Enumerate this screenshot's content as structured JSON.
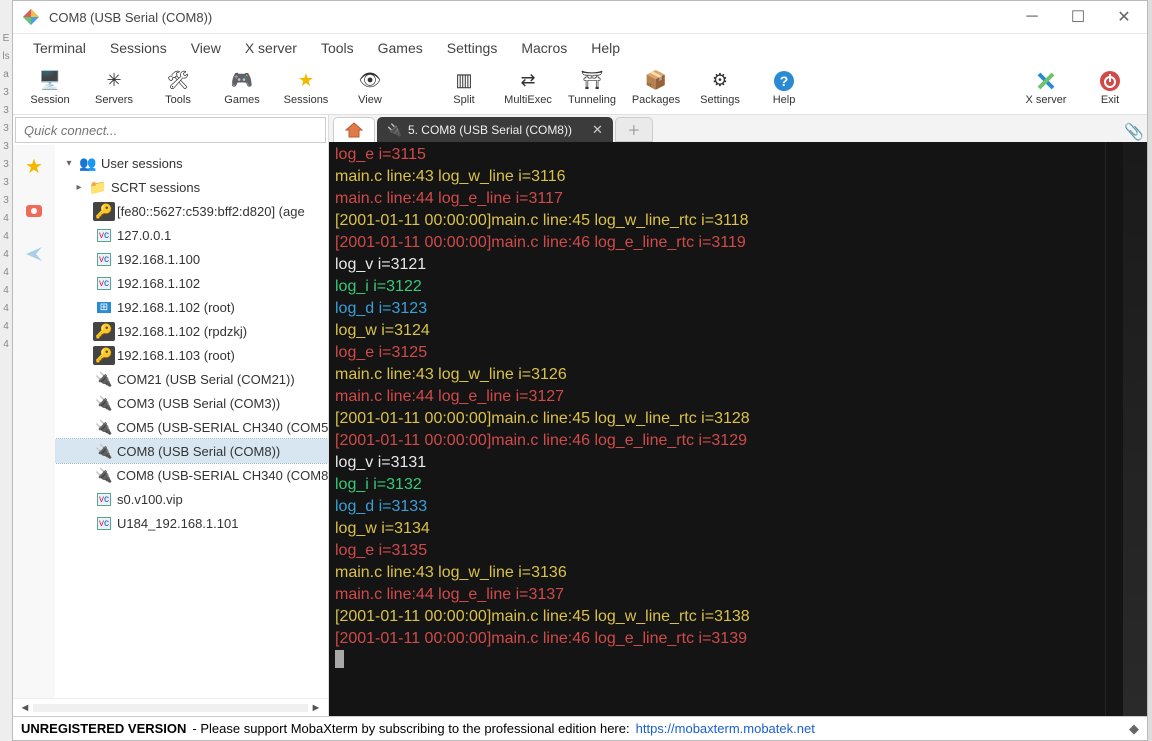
{
  "window": {
    "title": "COM8  (USB Serial (COM8))"
  },
  "menu": [
    "Terminal",
    "Sessions",
    "View",
    "X server",
    "Tools",
    "Games",
    "Settings",
    "Macros",
    "Help"
  ],
  "toolbar": [
    {
      "id": "session",
      "label": "Session",
      "icon": "🖥️"
    },
    {
      "id": "servers",
      "label": "Servers",
      "icon": "✳"
    },
    {
      "id": "tools",
      "label": "Tools",
      "icon": "🛠"
    },
    {
      "id": "games",
      "label": "Games",
      "icon": "🎮"
    },
    {
      "id": "sessions",
      "label": "Sessions",
      "icon": "⭐"
    },
    {
      "id": "view",
      "label": "View",
      "icon": "👁"
    },
    {
      "id": "split",
      "label": "Split",
      "icon": "▥"
    },
    {
      "id": "multiexec",
      "label": "MultiExec",
      "icon": "⇄"
    },
    {
      "id": "tunneling",
      "label": "Tunneling",
      "icon": "⛩"
    },
    {
      "id": "packages",
      "label": "Packages",
      "icon": "📦"
    },
    {
      "id": "settings",
      "label": "Settings",
      "icon": "⚙"
    },
    {
      "id": "help",
      "label": "Help",
      "icon": "?"
    }
  ],
  "toolbar_right": [
    {
      "id": "xserver",
      "label": "X server",
      "icon": "X"
    },
    {
      "id": "exit",
      "label": "Exit",
      "icon": "⏻"
    }
  ],
  "quick_connect_placeholder": "Quick connect...",
  "tree": {
    "root": "User sessions",
    "folder": "SCRT sessions",
    "items": [
      {
        "icon": "key",
        "label": "[fe80::5627:c539:bff2:d820] (age"
      },
      {
        "icon": "vc",
        "label": "127.0.0.1"
      },
      {
        "icon": "vc",
        "label": "192.168.1.100"
      },
      {
        "icon": "vc",
        "label": "192.168.1.102"
      },
      {
        "icon": "win",
        "label": "192.168.1.102 (root)"
      },
      {
        "icon": "key",
        "label": "192.168.1.102 (rpdzkj)"
      },
      {
        "icon": "key",
        "label": "192.168.1.103 (root)"
      },
      {
        "icon": "serial",
        "label": "COM21  (USB Serial (COM21))"
      },
      {
        "icon": "serial",
        "label": "COM3  (USB Serial (COM3))"
      },
      {
        "icon": "serial",
        "label": "COM5  (USB-SERIAL CH340 (COM5"
      },
      {
        "icon": "serial",
        "label": "COM8  (USB Serial (COM8))",
        "selected": true
      },
      {
        "icon": "serial",
        "label": "COM8  (USB-SERIAL CH340 (COM8"
      },
      {
        "icon": "vc",
        "label": "s0.v100.vip"
      },
      {
        "icon": "vc",
        "label": "U184_192.168.1.101"
      }
    ]
  },
  "tabs": {
    "active_label": "5. COM8  (USB Serial (COM8))"
  },
  "terminal_lines": [
    {
      "cls": "t-red",
      "text": "log_e i=3115"
    },
    {
      "cls": "t-yellow",
      "text": "main.c line:43 log_w_line i=3116"
    },
    {
      "cls": "t-red",
      "text": "main.c line:44 log_e_line i=3117"
    },
    {
      "cls": "t-ts-y",
      "text": "[2001-01-11 00:00:00]main.c line:45 log_w_line_rtc i=3118"
    },
    {
      "cls": "t-ts-r",
      "text": "[2001-01-11 00:00:00]main.c line:46 log_e_line_rtc i=3119"
    },
    {
      "cls": "t-white",
      "text": "log_v i=3121"
    },
    {
      "cls": "t-green",
      "text": "log_i i=3122"
    },
    {
      "cls": "t-cyan",
      "text": "log_d i=3123"
    },
    {
      "cls": "t-yellow",
      "text": "log_w i=3124"
    },
    {
      "cls": "t-red",
      "text": "log_e i=3125"
    },
    {
      "cls": "t-yellow",
      "text": "main.c line:43 log_w_line i=3126"
    },
    {
      "cls": "t-red",
      "text": "main.c line:44 log_e_line i=3127"
    },
    {
      "cls": "t-ts-y",
      "text": "[2001-01-11 00:00:00]main.c line:45 log_w_line_rtc i=3128"
    },
    {
      "cls": "t-ts-r",
      "text": "[2001-01-11 00:00:00]main.c line:46 log_e_line_rtc i=3129"
    },
    {
      "cls": "t-white",
      "text": "log_v i=3131"
    },
    {
      "cls": "t-green",
      "text": "log_i i=3132"
    },
    {
      "cls": "t-cyan",
      "text": "log_d i=3133"
    },
    {
      "cls": "t-yellow",
      "text": "log_w i=3134"
    },
    {
      "cls": "t-red",
      "text": "log_e i=3135"
    },
    {
      "cls": "t-yellow",
      "text": "main.c line:43 log_w_line i=3136"
    },
    {
      "cls": "t-red",
      "text": "main.c line:44 log_e_line i=3137"
    },
    {
      "cls": "t-ts-y",
      "text": "[2001-01-11 00:00:00]main.c line:45 log_w_line_rtc i=3138"
    },
    {
      "cls": "t-ts-r",
      "text": "[2001-01-11 00:00:00]main.c line:46 log_e_line_rtc i=3139"
    }
  ],
  "status": {
    "unreg": "UNREGISTERED VERSION",
    "mid": "-  Please support MobaXterm by subscribing to the professional edition here:",
    "link": "https://mobaxterm.mobatek.net"
  },
  "left_strip": [
    "E",
    "ls",
    "a",
    "3",
    "3",
    "3",
    "3",
    "3",
    "3",
    "3",
    "4",
    "4",
    "4",
    "4",
    "4",
    "4",
    "4",
    "4"
  ]
}
